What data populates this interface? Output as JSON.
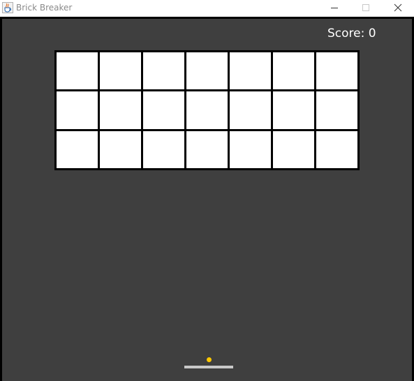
{
  "window": {
    "title": "Brick Breaker",
    "app_icon": "java-cup-icon",
    "controls": [
      "minimize-icon",
      "maximize-icon",
      "close-icon"
    ]
  },
  "game": {
    "score_label": "Score: 0",
    "score": 0,
    "brick_rows": 3,
    "brick_cols": 7,
    "bricks_remaining": 21,
    "colors": {
      "background": "#3f3f3f",
      "brick": "#ffffff",
      "brick_border": "#000000",
      "ball": "#ffc800",
      "paddle": "#c8c8c8",
      "score_text": "#ffffff"
    }
  }
}
